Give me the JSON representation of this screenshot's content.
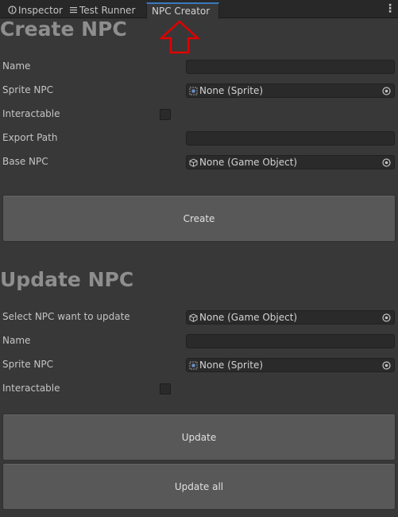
{
  "tabs": [
    {
      "label": "Inspector",
      "icon": "info-icon"
    },
    {
      "label": "Test Runner",
      "icon": "list-icon"
    },
    {
      "label": "NPC Creator",
      "active": true
    }
  ],
  "colors": {
    "background": "#383838",
    "tabbar": "#282828",
    "active_tab_accent": "#3a79bb",
    "field_bg": "#2a2a2a",
    "button_bg": "#585858",
    "annotation_arrow": "#e00000"
  },
  "create_section": {
    "title": "Create NPC",
    "fields": {
      "name_label": "Name",
      "name_value": "",
      "sprite_label": "Sprite NPC",
      "sprite_value": "None (Sprite)",
      "interactable_label": "Interactable",
      "interactable_checked": false,
      "export_path_label": "Export Path",
      "export_path_value": "",
      "base_npc_label": "Base NPC",
      "base_npc_value": "None (Game Object)"
    },
    "create_button": "Create"
  },
  "update_section": {
    "title": "Update NPC",
    "fields": {
      "select_label": "Select NPC want to update",
      "select_value": "None (Game Object)",
      "name_label": "Name",
      "name_value": "",
      "sprite_label": "Sprite NPC",
      "sprite_value": "None (Sprite)",
      "interactable_label": "Interactable",
      "interactable_checked": false
    },
    "update_button": "Update",
    "update_all_button": "Update all"
  }
}
